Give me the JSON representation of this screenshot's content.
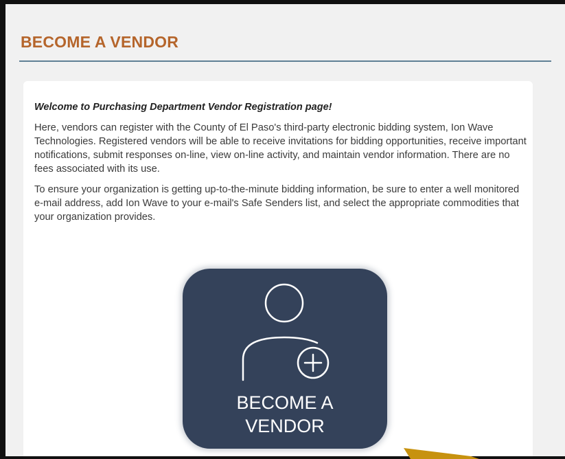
{
  "page": {
    "title": "BECOME A VENDOR"
  },
  "content": {
    "welcome": "Welcome to Purchasing Department Vendor Registration page!",
    "paragraph_1": "Here, vendors can register with the County of El Paso's third-party electronic bidding system, Ion Wave Technologies. Registered vendors will be able to receive invitations for bidding opportunities, receive important notifications, submit responses on-line, view on-line activity, and maintain vendor information. There are no fees associated with its use.",
    "paragraph_2": "To ensure your organization is getting up-to-the-minute bidding information, be sure to enter a well monitored e-mail address, add Ion Wave to your e-mail's Safe Senders list, and select the appropriate commodities that your organization provides."
  },
  "button": {
    "line_1": "BECOME A",
    "line_2": "VENDOR",
    "icon": "user-add-icon",
    "bg_color": "#34425a"
  },
  "colors": {
    "title": "#b5652b",
    "rule": "#5f7f95",
    "arrow": "#c7920f"
  }
}
